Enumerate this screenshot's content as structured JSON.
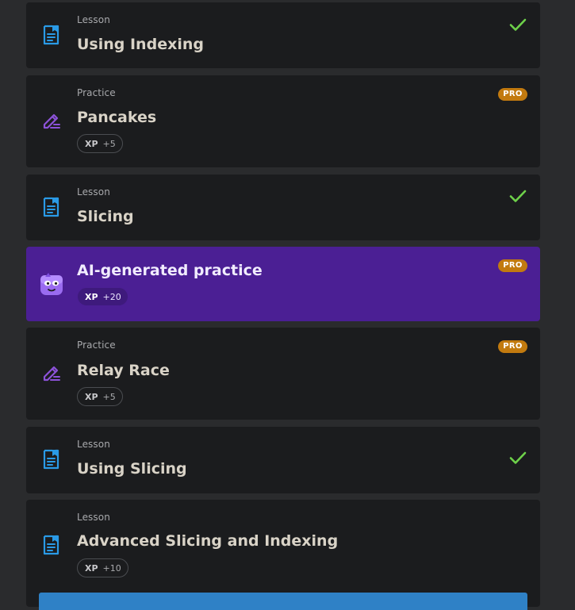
{
  "items": [
    {
      "kind": "Lesson",
      "title": "Using Indexing",
      "icon": "lesson-document-icon",
      "completed": true
    },
    {
      "kind": "Practice",
      "title": "Pancakes",
      "icon": "practice-pencil-icon",
      "badge": "PRO",
      "xp_label": "XP",
      "xp_value": "+5"
    },
    {
      "kind": "Lesson",
      "title": "Slicing",
      "icon": "lesson-document-icon",
      "completed": true
    },
    {
      "title": "AI-generated practice",
      "icon": "ai-mascot-icon",
      "badge": "PRO",
      "xp_label": "XP",
      "xp_value": "+20"
    },
    {
      "kind": "Practice",
      "title": "Relay Race",
      "icon": "practice-pencil-icon",
      "badge": "PRO",
      "xp_label": "XP",
      "xp_value": "+5"
    },
    {
      "kind": "Lesson",
      "title": "Using Slicing",
      "icon": "lesson-document-icon",
      "completed": true
    },
    {
      "kind": "Lesson",
      "title": "Advanced Slicing and Indexing",
      "icon": "lesson-document-icon",
      "xp_label": "XP",
      "xp_value": "+10"
    }
  ],
  "colors": {
    "lesson_icon": "#2a9ae6",
    "practice_icon": "#8c52d9",
    "check": "#6ed14a",
    "pro_badge": "#c27a0f",
    "ai_card": "#4b1f94",
    "cta_button": "#2f81c6"
  }
}
